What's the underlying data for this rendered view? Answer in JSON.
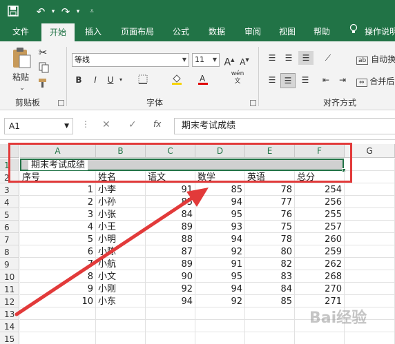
{
  "tabs": [
    "文件",
    "开始",
    "插入",
    "页面布局",
    "公式",
    "数据",
    "审阅",
    "视图",
    "帮助",
    "操作说明"
  ],
  "active_tab": "开始",
  "ribbon": {
    "clipboard": {
      "paste_label": "粘贴",
      "group_label": "剪贴板"
    },
    "font": {
      "font_name": "等线",
      "font_size": "11",
      "group_label": "字体",
      "bold": "B",
      "italic": "I",
      "underline": "U",
      "grow": "A",
      "shrink": "A",
      "phonetic": "wén"
    },
    "alignment": {
      "wrap_label": "自动换",
      "merge_label": "合并后",
      "group_label": "对齐方式"
    }
  },
  "formula_bar": {
    "cell_ref": "A1",
    "content": "期末考试成绩",
    "fx": "fx"
  },
  "columns": [
    "A",
    "B",
    "C",
    "D",
    "E",
    "F",
    "G"
  ],
  "rows": [
    "1",
    "2",
    "3",
    "4",
    "5",
    "6",
    "7",
    "8",
    "9",
    "10",
    "11",
    "12",
    "13",
    "14",
    "15"
  ],
  "merged_title": "期末考试成绩",
  "headers": [
    "序号",
    "姓名",
    "语文",
    "数学",
    "英语",
    "总分"
  ],
  "table": [
    [
      "1",
      "小李",
      "91",
      "85",
      "78",
      "254"
    ],
    [
      "2",
      "小孙",
      "85",
      "94",
      "77",
      "256"
    ],
    [
      "3",
      "小张",
      "84",
      "95",
      "76",
      "255"
    ],
    [
      "4",
      "小王",
      "89",
      "93",
      "75",
      "257"
    ],
    [
      "5",
      "小明",
      "88",
      "94",
      "78",
      "260"
    ],
    [
      "6",
      "小陈",
      "87",
      "92",
      "80",
      "259"
    ],
    [
      "7",
      "小航",
      "89",
      "91",
      "82",
      "262"
    ],
    [
      "8",
      "小文",
      "90",
      "95",
      "83",
      "268"
    ],
    [
      "9",
      "小刚",
      "92",
      "94",
      "84",
      "270"
    ],
    [
      "10",
      "小东",
      "94",
      "92",
      "85",
      "271"
    ]
  ],
  "colors": {
    "excel_green": "#217346",
    "annotation_red": "#e23a3a"
  },
  "watermark": "Bai经验"
}
